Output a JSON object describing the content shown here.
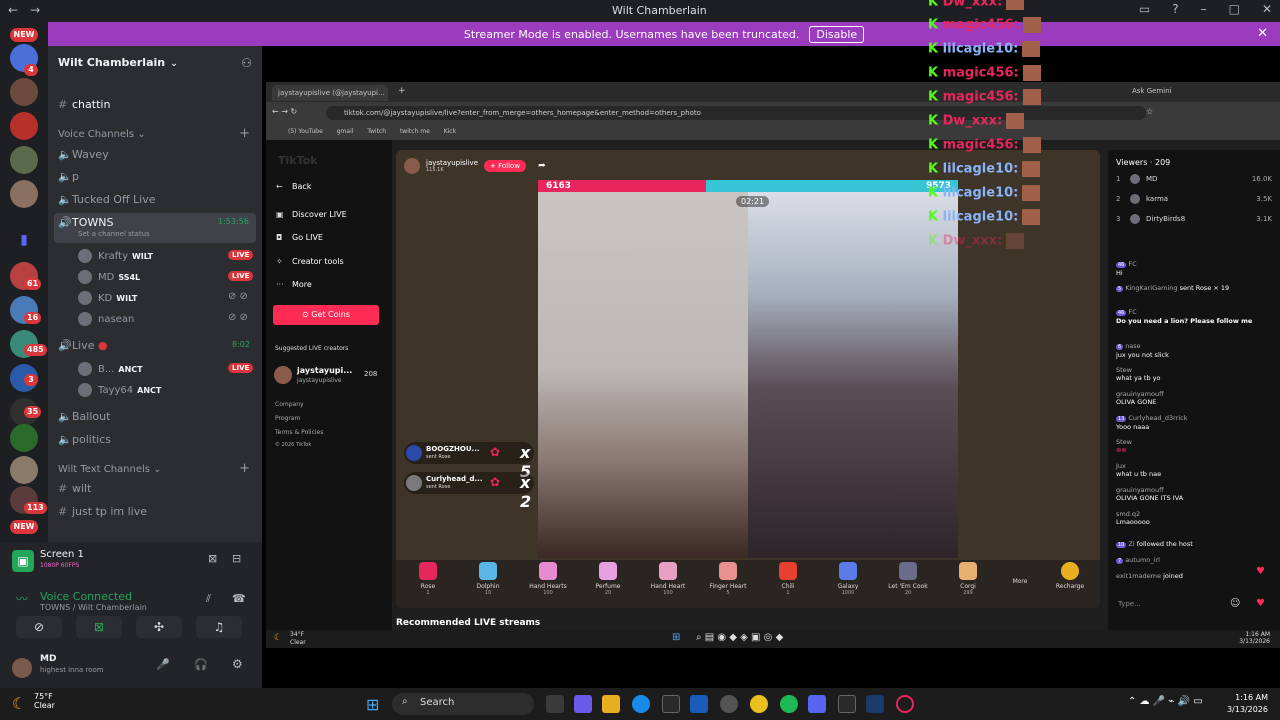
{
  "discord": {
    "window_title": "Wilt Chamberlain",
    "banner": {
      "text": "Streamer Mode is enabled. Usernames have been truncated.",
      "button": "Disable"
    },
    "rail_badges": [
      "NEW",
      "4",
      "61",
      "16",
      "485",
      "3",
      "35",
      "113",
      "NEW"
    ],
    "server_name": "Wilt Chamberlain",
    "channels": {
      "chattin": "chattin",
      "voice_category": "Voice Channels",
      "voice": [
        "Wavey",
        "p",
        "Tucked Off Live"
      ],
      "towns": {
        "name": "TOWNS",
        "status": "Set a channel status",
        "timer": "1:53:56"
      },
      "towns_users": [
        {
          "name": "Krafty",
          "tag": "WILT",
          "live": "LIVE"
        },
        {
          "name": "MD",
          "tag": "SS4L",
          "live": "LIVE"
        },
        {
          "name": "KD",
          "tag": "WILT"
        },
        {
          "name": "nasean"
        }
      ],
      "live_channel": {
        "name": "Live",
        "timer": "8:02"
      },
      "live_users": [
        {
          "name": "B...",
          "tag": "ANCT",
          "live": "LIVE"
        },
        {
          "name": "Tayy64",
          "tag": "ANCT"
        }
      ],
      "more_voice": [
        "Ballout",
        "politics"
      ],
      "text_category": "Wilt Text Channels",
      "text": [
        "wilt",
        "just tp im live"
      ]
    },
    "voice_panel": {
      "screen_title": "Screen 1",
      "screen_sub": "1080P 60FPS",
      "status": "Voice Connected",
      "location": "TOWNS / Wilt Chamberlain"
    },
    "user_panel": {
      "name": "MD",
      "status": "highest inna room"
    }
  },
  "overlay_chat": [
    {
      "name": "Dw_xxx:",
      "color": "#e8265e"
    },
    {
      "name": "magic456:",
      "color": "#e8265e"
    },
    {
      "name": "lilcagle10:",
      "color": "#8ab4f8"
    },
    {
      "name": "magic456:",
      "color": "#e8265e"
    },
    {
      "name": "magic456:",
      "color": "#e8265e"
    },
    {
      "name": "Dw_xxx:",
      "color": "#e8265e"
    },
    {
      "name": "magic456:",
      "color": "#e8265e"
    },
    {
      "name": "lilcagle10:",
      "color": "#8ab4f8"
    },
    {
      "name": "lilcagle10:",
      "color": "#8ab4f8"
    },
    {
      "name": "lilcagle10:",
      "color": "#8ab4f8"
    },
    {
      "name": "Dw_xxx:",
      "color": "#e8265e"
    }
  ],
  "browser": {
    "tab_title": "jaystayupislive (@jaystayupi...",
    "ask_gemini": "Ask Gemini",
    "url": "tiktok.com/@jaystayupislive/live?enter_from_merge=others_homepage&enter_method=others_photo",
    "bookmarks": [
      "(5) YouTube",
      "gmail",
      "Twitch",
      "twitch me",
      "Kick"
    ],
    "tiktok": {
      "logo": "TikTok",
      "back": "Back",
      "menu": [
        "Discover LIVE",
        "Go LIVE",
        "Creator tools",
        "More"
      ],
      "get_coins": "Get Coins",
      "suggested_label": "Suggested LIVE creators",
      "suggested": {
        "name": "jaystayupi...",
        "handle": "jaystayupislive",
        "count": "208"
      },
      "footer": [
        "Company",
        "Program",
        "Terms & Policies",
        "© 2026 TikTok"
      ],
      "host": {
        "name": "jaystayupislive",
        "likes": "115.1K",
        "follow": "+ Follow"
      },
      "battle": {
        "left_score": "6163",
        "right_score": "9573",
        "timer": "02:21"
      },
      "gift_pops": [
        {
          "user": "BOOGZHOU...",
          "action": "sent Rose",
          "mult": "x 5"
        },
        {
          "user": "Curlyhead_d...",
          "action": "sent Rose",
          "mult": "x 2"
        }
      ],
      "gifts": [
        {
          "name": "Rose",
          "price": "1",
          "color": "#e8265e"
        },
        {
          "name": "Dolphin",
          "price": "10",
          "color": "#5bb6e8"
        },
        {
          "name": "Hand Hearts",
          "price": "100",
          "color": "#e88ad0"
        },
        {
          "name": "Perfume",
          "price": "20",
          "color": "#e8a0e0"
        },
        {
          "name": "Hand Heart",
          "price": "100",
          "color": "#e8a0c0"
        },
        {
          "name": "Finger Heart",
          "price": "5",
          "color": "#e89090"
        },
        {
          "name": "Chili",
          "price": "1",
          "color": "#e84030"
        },
        {
          "name": "Galaxy",
          "price": "1000",
          "color": "#5b7be8"
        },
        {
          "name": "Let 'Em Cook",
          "price": "20",
          "color": "#6b6b8b"
        },
        {
          "name": "Corgi",
          "price": "299",
          "color": "#e8b070"
        }
      ],
      "more": "More",
      "recharge": "Recharge",
      "recommended": "Recommended LIVE streams",
      "viewers": {
        "title": "Viewers · 209",
        "top": [
          {
            "rank": "1",
            "name": "MD",
            "count": "16.0K"
          },
          {
            "rank": "2",
            "name": "karma",
            "count": "3.5K"
          },
          {
            "rank": "3",
            "name": "DirtyBirds8",
            "count": "3.1K"
          }
        ]
      },
      "chat": [
        {
          "name": "FC",
          "text": "Hi"
        },
        {
          "name": "KingKariGaming",
          "text": "sent Rose × 19"
        },
        {
          "name": "FC",
          "text": "Do you need a lion? Please follow me"
        },
        {
          "name": "nase",
          "text": "jux you not slick"
        },
        {
          "name": "Stew",
          "text": "what ya tb yo"
        },
        {
          "name": "grauinyamouff",
          "text": "OLIVA GONE"
        },
        {
          "name": "Curlyhead_d3rrick",
          "text": "Yooo naaa"
        },
        {
          "name": "Stew",
          "text": ""
        },
        {
          "name": "Jux",
          "text": "what u tb nae"
        },
        {
          "name": "grauinyamouff",
          "text": "OLIVIA GONE ITS IVA"
        },
        {
          "name": "smd.q2",
          "text": "Lmaooooo"
        },
        {
          "name": "Zi",
          "text": "followed the host"
        },
        {
          "name": "autumn_irl",
          "text": ""
        },
        {
          "name": "exit1mademe",
          "text": "joined"
        }
      ],
      "type_placeholder": "Type..."
    }
  },
  "inner_taskbar": {
    "temp": "34°F",
    "cond": "Clear",
    "time": "1:16 AM",
    "date": "3/13/2026"
  },
  "taskbar": {
    "temp": "75°F",
    "cond": "Clear",
    "search": "Search",
    "time": "1:16 AM",
    "date": "3/13/2026"
  }
}
